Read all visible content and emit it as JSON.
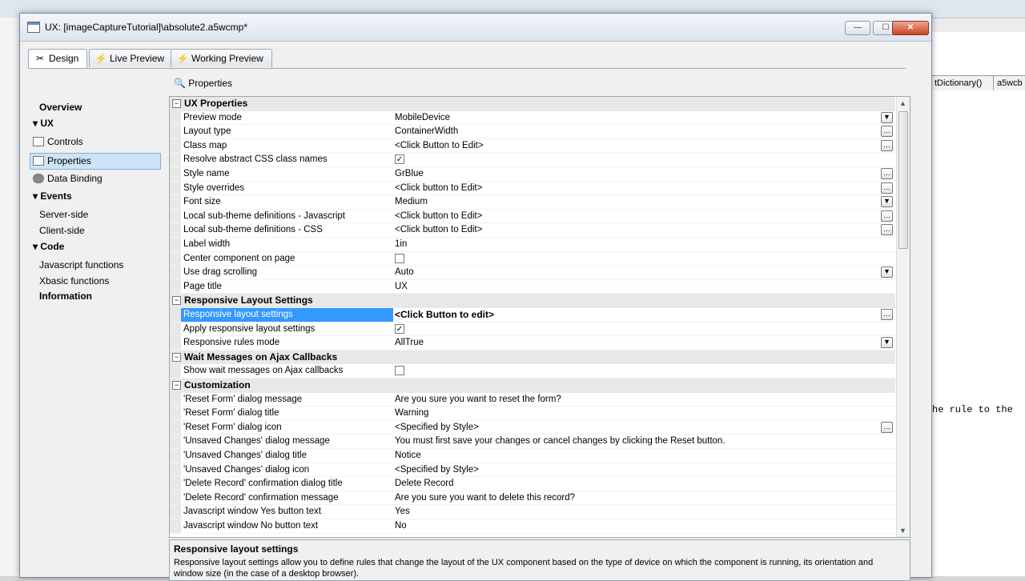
{
  "background": {
    "tabs": [
      "tDictionary()",
      "a5wcb"
    ],
    "code_text": "he rule to the"
  },
  "window": {
    "title": "UX: [imageCaptureTutorial]\\absolute2.a5wcmp*",
    "buttons": {
      "minimize": "—",
      "maximize": "☐",
      "close": "✕"
    }
  },
  "tabs": [
    {
      "label": "Design",
      "icon": "design-tools-icon"
    },
    {
      "label": "Live Preview",
      "icon": "lightning-icon"
    },
    {
      "label": "Working Preview",
      "icon": "lightning-icon"
    }
  ],
  "properties_label": "Properties",
  "nav": {
    "overview": "Overview",
    "ux": "UX",
    "controls": "Controls",
    "properties": "Properties",
    "data_binding": "Data Binding",
    "events": "Events",
    "server_side": "Server-side",
    "client_side": "Client-side",
    "code": "Code",
    "javascript_functions": "Javascript functions",
    "xbasic_functions": "Xbasic functions",
    "information": "Information"
  },
  "grid": {
    "rows": [
      {
        "type": "category",
        "title": "UX Properties"
      },
      {
        "name": "Preview mode",
        "value": "MobileDevice",
        "control": "dropdown"
      },
      {
        "name": "Layout type",
        "value": "ContainerWidth",
        "control": "ellipsis"
      },
      {
        "name": "Class map",
        "value": "<Click Button to Edit>",
        "control": "ellipsis"
      },
      {
        "name": "Resolve abstract CSS class names",
        "value": "",
        "control": "checkbox",
        "checked": true
      },
      {
        "name": "Style name",
        "value": "GrBlue",
        "control": "ellipsis"
      },
      {
        "name": "Style overrides",
        "value": "<Click button to Edit>",
        "control": "ellipsis"
      },
      {
        "name": "Font size",
        "value": "Medium",
        "control": "dropdown"
      },
      {
        "name": "Local sub-theme definitions - Javascript",
        "value": "<Click button to Edit>",
        "control": "ellipsis"
      },
      {
        "name": "Local sub-theme definitions - CSS",
        "value": "<Click button to Edit>",
        "control": "ellipsis"
      },
      {
        "name": "Label width",
        "value": "1in",
        "control": "none"
      },
      {
        "name": "Center component on page",
        "value": "",
        "control": "checkbox",
        "checked": false
      },
      {
        "name": "Use drag scrolling",
        "value": "Auto",
        "control": "dropdown"
      },
      {
        "name": "Page title",
        "value": "UX",
        "control": "none"
      },
      {
        "type": "category",
        "title": "Responsive Layout Settings"
      },
      {
        "name": "Responsive layout settings",
        "value": "<Click Button to edit>",
        "control": "ellipsis",
        "selected": true
      },
      {
        "name": "Apply responsive layout settings",
        "value": "",
        "control": "checkbox",
        "checked": true
      },
      {
        "name": "Responsive rules mode",
        "value": "AllTrue",
        "control": "dropdown"
      },
      {
        "type": "category",
        "title": "Wait Messages on Ajax Callbacks"
      },
      {
        "name": "Show wait messages on Ajax callbacks",
        "value": "",
        "control": "checkbox",
        "checked": false
      },
      {
        "type": "category",
        "title": "Customization"
      },
      {
        "name": "'Reset Form' dialog message",
        "value": "Are you sure you want to reset the form?",
        "control": "none"
      },
      {
        "name": "'Reset Form' dialog title",
        "value": "Warning",
        "control": "none"
      },
      {
        "name": "'Reset Form' dialog icon",
        "value": "<Specified by Style>",
        "control": "ellipsis"
      },
      {
        "name": "'Unsaved Changes' dialog message",
        "value": "You must first save your changes or cancel changes by clicking the Reset button.",
        "control": "none"
      },
      {
        "name": "'Unsaved Changes' dialog title",
        "value": "Notice",
        "control": "none"
      },
      {
        "name": "'Unsaved Changes' dialog icon",
        "value": "<Specified by Style>",
        "control": "none"
      },
      {
        "name": "'Delete Record' confirmation dialog title",
        "value": "Delete Record",
        "control": "none"
      },
      {
        "name": "'Delete Record' confirmation  message",
        "value": "Are you sure you want to delete this record?",
        "control": "none"
      },
      {
        "name": "Javascript window Yes button text",
        "value": "Yes",
        "control": "none"
      },
      {
        "name": "Javascript window No button text",
        "value": "No",
        "control": "none"
      }
    ]
  },
  "description": {
    "title": "Responsive layout settings",
    "body": "Responsive layout settings allow you to define rules that change the layout of the UX component based on the type of device on which the component is running, its orientation and window size (in the case of a desktop browser)."
  }
}
